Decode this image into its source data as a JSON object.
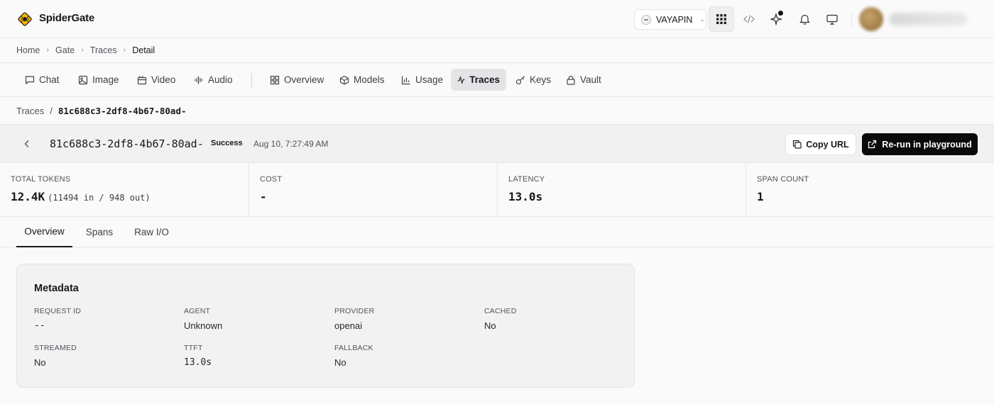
{
  "app": {
    "name": "SpiderGate"
  },
  "org": {
    "name": "VAYAPIN"
  },
  "breadcrumb": [
    "Home",
    "Gate",
    "Traces",
    "Detail"
  ],
  "nav": {
    "items": [
      {
        "label": "Chat",
        "icon": "chat-bubble-icon"
      },
      {
        "label": "Image",
        "icon": "image-icon"
      },
      {
        "label": "Video",
        "icon": "film-icon"
      },
      {
        "label": "Audio",
        "icon": "audio-waveform-icon"
      },
      {
        "label": "Overview",
        "icon": "grid-icon"
      },
      {
        "label": "Models",
        "icon": "cube-icon"
      },
      {
        "label": "Usage",
        "icon": "bar-chart-icon"
      },
      {
        "label": "Traces",
        "icon": "activity-icon",
        "active": true
      },
      {
        "label": "Keys",
        "icon": "key-icon"
      },
      {
        "label": "Vault",
        "icon": "lock-icon"
      }
    ]
  },
  "path": {
    "root": "Traces",
    "separator": "/",
    "trace_id": "81c688c3-2df8-4b67-80ad-"
  },
  "trace": {
    "id": "81c688c3-2df8-4b67-80ad-",
    "status": "Success",
    "timestamp": "Aug 10, 7:27:49 AM",
    "copy_label": "Copy URL",
    "rerun_label": "Re-run in playground"
  },
  "stats": [
    {
      "label": "TOTAL TOKENS",
      "value": "12.4K",
      "sub": "(11494 in / 948 out)"
    },
    {
      "label": "COST",
      "value": "-"
    },
    {
      "label": "LATENCY",
      "value": "13.0s"
    },
    {
      "label": "SPAN COUNT",
      "value": "1"
    }
  ],
  "tabs": [
    {
      "label": "Overview",
      "active": true
    },
    {
      "label": "Spans"
    },
    {
      "label": "Raw I/O"
    }
  ],
  "metadata": {
    "title": "Metadata",
    "fields": [
      {
        "key": "REQUEST ID",
        "value": "--"
      },
      {
        "key": "AGENT",
        "value": "Unknown"
      },
      {
        "key": "PROVIDER",
        "value": "openai"
      },
      {
        "key": "CACHED",
        "value": "No"
      },
      {
        "key": "STREAMED",
        "value": "No"
      },
      {
        "key": "TTFT",
        "value": "13.0s"
      },
      {
        "key": "FALLBACK",
        "value": "No"
      }
    ]
  },
  "colors": {
    "primary": "#0a0a0a",
    "logo": "#f5b400",
    "border": "#e7e7e9"
  }
}
